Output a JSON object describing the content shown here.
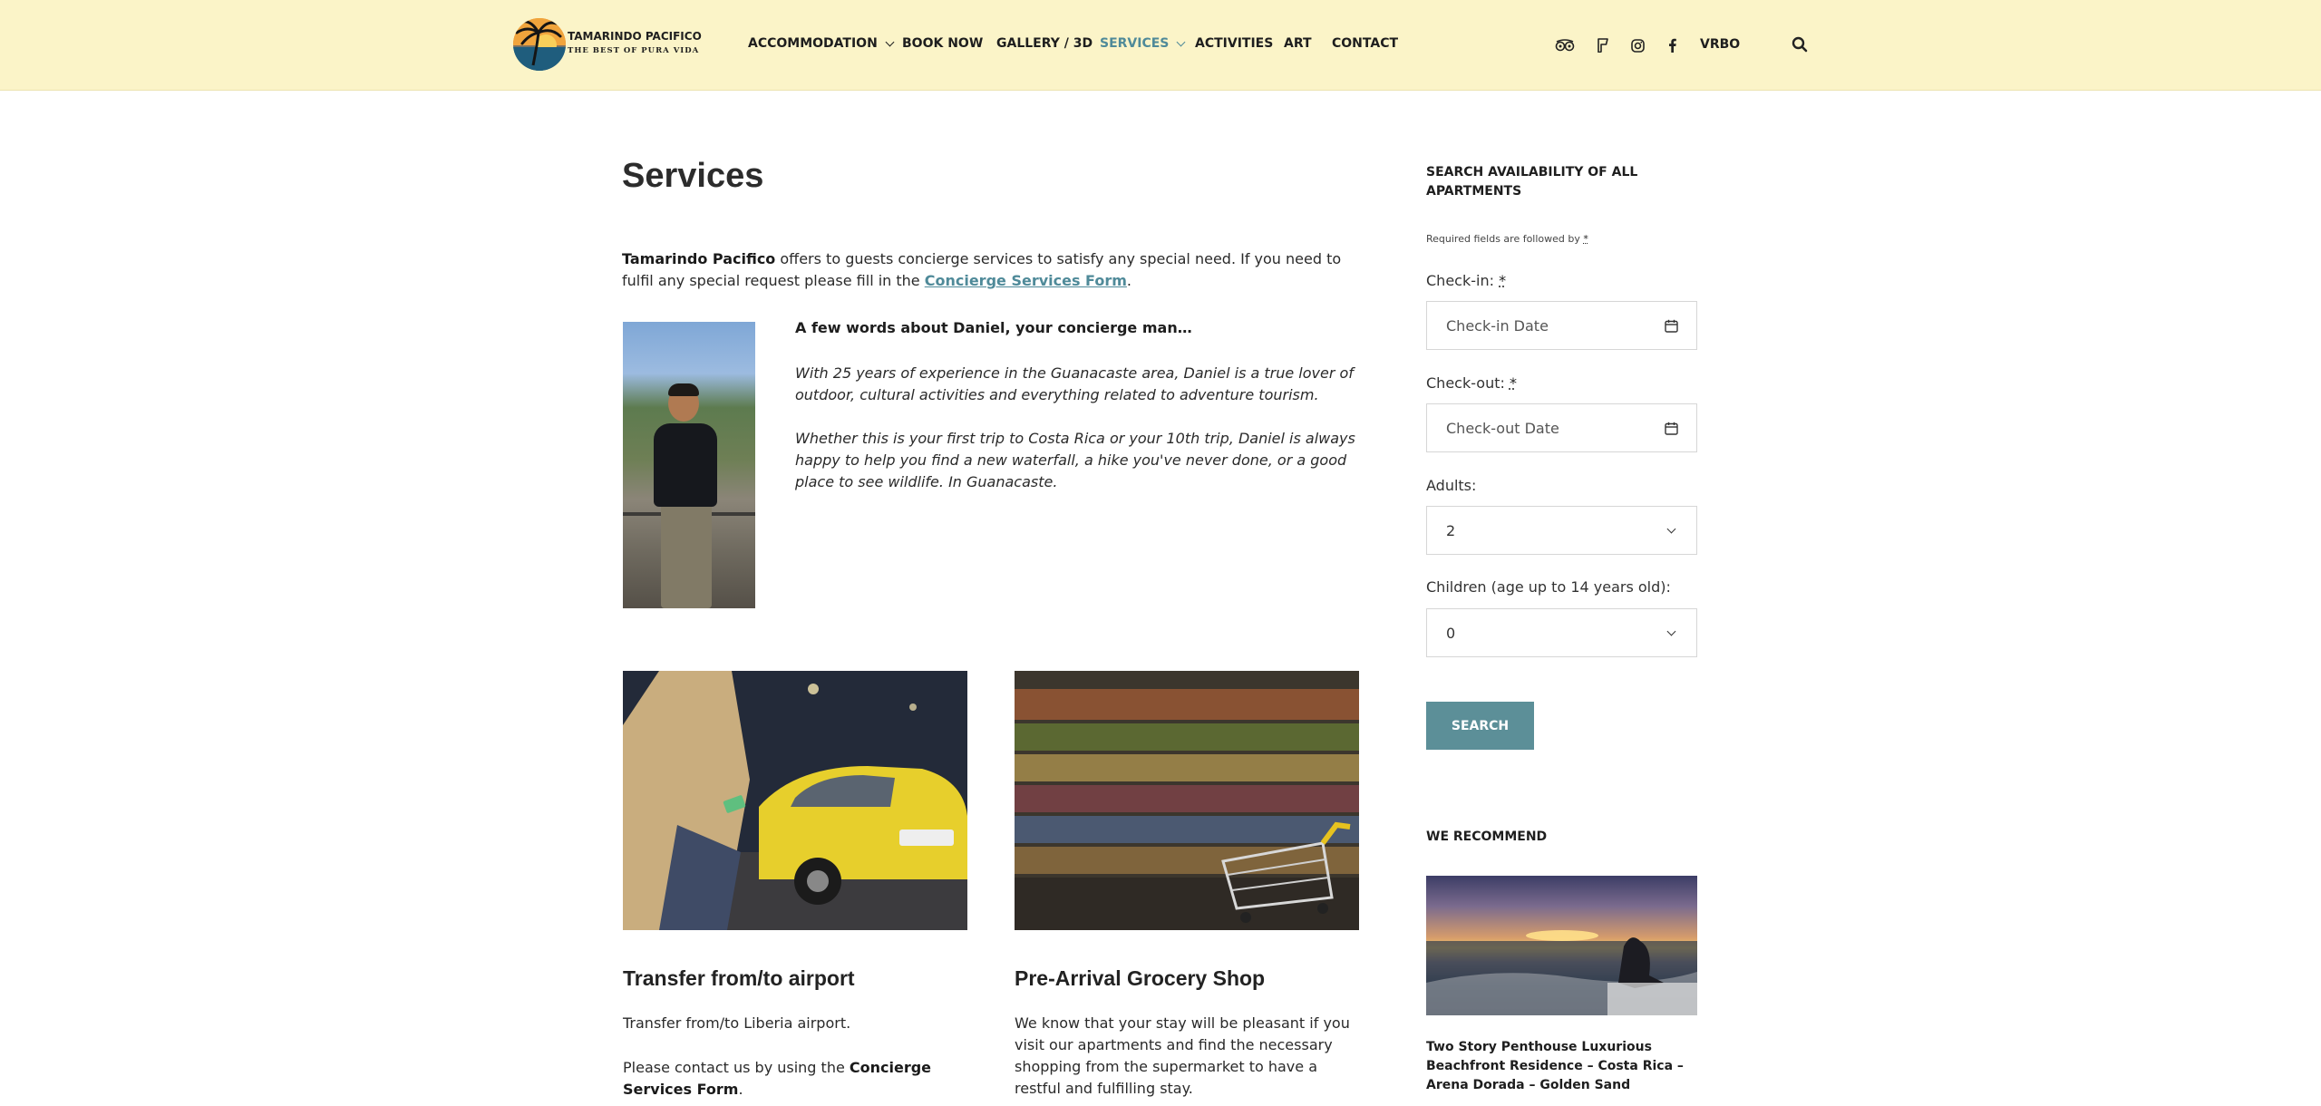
{
  "header": {
    "logo": {
      "title": "TAMARINDO PACIFICO",
      "subtitle": "THE BEST OF PURA VIDA"
    },
    "nav": [
      {
        "label": "ACCOMMODATION",
        "dropdown": true
      },
      {
        "label": "BOOK NOW"
      },
      {
        "label": "GALLERY / 3D"
      },
      {
        "label": "SERVICES",
        "dropdown": true,
        "active": true
      },
      {
        "label": "ACTIVITIES"
      },
      {
        "label": "ART"
      },
      {
        "label": "CONTACT"
      }
    ],
    "social_icons": [
      "tripadvisor-icon",
      "foursquare-icon",
      "instagram-icon",
      "facebook-icon"
    ],
    "vrbo_label": "VRBO",
    "search_icon": "search-icon",
    "active_color": "#4f8a99",
    "background_color": "#fbf4c8"
  },
  "main": {
    "title": "Services",
    "intro": {
      "brand": "Tamarindo Pacifico",
      "text_before_link": " offers to guests concierge services to satisfy any special need. If you need to fulfil any special request please fill in the ",
      "link": "Concierge Services Form",
      "text_after_link": "."
    },
    "about": {
      "heading": "A few words about Daniel, your concierge man…",
      "p1": "With 25 years of experience in the Guanacaste area, Daniel is a true lover of outdoor, cultural activities and everything related to adventure tourism.",
      "p2": "Whether this is your first trip to Costa Rica or your 10th trip, Daniel is always happy to help you find a new waterfall, a hike you've never done, or a good place to see wildlife. In Guanacaste."
    },
    "cards": [
      {
        "title": "Transfer from/to airport",
        "text1": "Transfer from/to Liberia airport.",
        "text2_before": "Please contact us by using the ",
        "text2_bold": "Concierge Services Form",
        "text2_after": "."
      },
      {
        "title": "Pre-Arrival Grocery Shop",
        "text1": "We know that your stay will be pleasant if you visit our apartments and find the necessary shopping from the supermarket to have a restful and fulfilling stay."
      }
    ]
  },
  "sidebar": {
    "heading": "SEARCH AVAILABILITY OF ALL APARTMENTS",
    "required_note": "Required fields are followed by ",
    "asterisk": "*",
    "checkin": {
      "label": "Check-in: ",
      "placeholder": "Check-in Date"
    },
    "checkout": {
      "label": "Check-out: ",
      "placeholder": "Check-out Date"
    },
    "adults": {
      "label": "Adults:",
      "value": "2"
    },
    "children": {
      "label": "Children (age up to 14 years old):",
      "value": "0"
    },
    "search_button": "SEARCH",
    "button_color": "#5c8f98",
    "recommend": {
      "heading": "WE RECOMMEND",
      "title": "Two Story Penthouse Luxurious Beachfront Residence – Costa Rica – Arena Dorada – Golden Sand"
    }
  }
}
